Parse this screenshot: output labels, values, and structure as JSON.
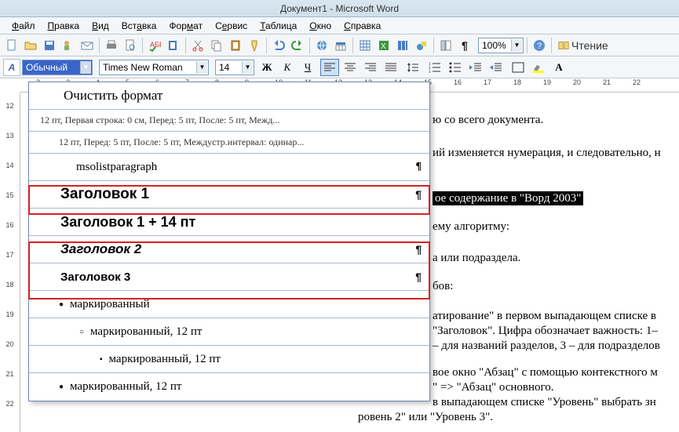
{
  "title": "Документ1 - Microsoft Word",
  "menus": [
    "Файл",
    "Правка",
    "Вид",
    "Вставка",
    "Формат",
    "Сервис",
    "Таблица",
    "Окно",
    "Справка"
  ],
  "zoom": "100%",
  "reading": "Чтение",
  "style_current": "Обычный",
  "font_current": "Times New Roman",
  "size_current": "14",
  "styles": {
    "clear": "Очистить формат",
    "desc1": "12 пт, Первая строка:  0 см, Перед:  5 пт, После:  5 пт, Межд...",
    "desc2": "12 пт, Перед:  5 пт, После:  5 пт, Междустр.интервал:  одинар...",
    "mso": "msolistparagraph",
    "h1": "Заголовок 1",
    "h1p": "Заголовок 1 + 14 пт",
    "h2": "Заголовок 2",
    "h3": "Заголовок 3",
    "b1": "маркированный",
    "b2": "маркированный, 12 пт",
    "b3": "маркированный, 12 пт",
    "b4": "маркированный, 12 пт"
  },
  "doc": {
    "l1": "ю со всего документа.",
    "l2": "ий изменяется нумерация, и следовательно, н",
    "l3": "ое содержание в \"Ворд 2003\"",
    "l4": "ему алгоритму:",
    "l5": "а или подраздела.",
    "l6": "бов:",
    "l7a": "атирование\" в первом выпадающем списке в",
    "l7b": "\"Заголовок\". Цифра обозначает важность: 1–",
    "l7c": "– для названий разделов, 3 – для подразделов",
    "l8a": "вое окно \"Абзац\" с помощью контекстного м",
    "l8b": "\" => \"Абзац\" основного.",
    "l8c": "в выпадающем списке \"Уровень\" выбрать зн",
    "l8d": "ровень 2\" или \"Уровень 3\"."
  }
}
